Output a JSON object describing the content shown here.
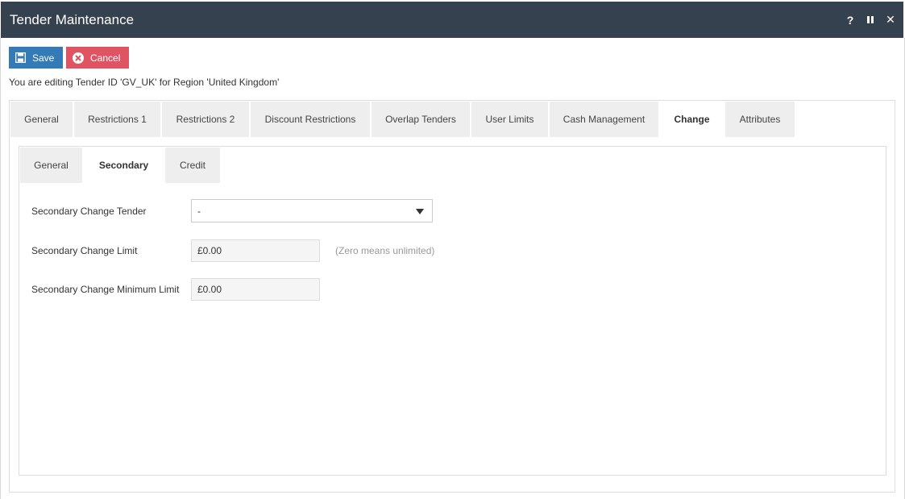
{
  "window": {
    "title": "Tender Maintenance",
    "controls": {
      "help": "?",
      "close": "✕"
    }
  },
  "toolbar": {
    "save_label": "Save",
    "cancel_label": "Cancel"
  },
  "edit_info": "You are editing Tender ID 'GV_UK' for Region 'United Kingdom'",
  "tabs": [
    {
      "label": "General"
    },
    {
      "label": "Restrictions 1"
    },
    {
      "label": "Restrictions 2"
    },
    {
      "label": "Discount Restrictions"
    },
    {
      "label": "Overlap Tenders"
    },
    {
      "label": "User Limits"
    },
    {
      "label": "Cash Management"
    },
    {
      "label": "Change"
    },
    {
      "label": "Attributes"
    }
  ],
  "active_tab": "Change",
  "subtabs": [
    {
      "label": "General"
    },
    {
      "label": "Secondary"
    },
    {
      "label": "Credit"
    }
  ],
  "active_subtab": "Secondary",
  "form": {
    "secondary_change_tender": {
      "label": "Secondary Change Tender",
      "value": "-"
    },
    "secondary_change_limit": {
      "label": "Secondary Change Limit",
      "value": "£0.00",
      "hint": "(Zero means unlimited)"
    },
    "secondary_change_minimum_limit": {
      "label": "Secondary Change Minimum Limit",
      "value": "£0.00"
    }
  },
  "colors": {
    "titlebar": "#364150",
    "save": "#337ab7",
    "cancel": "#e05362"
  }
}
